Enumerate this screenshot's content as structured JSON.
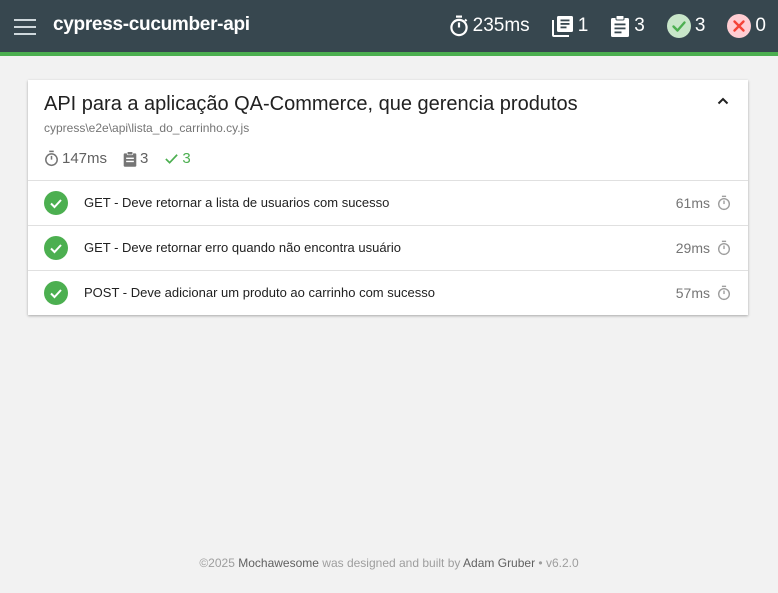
{
  "app": {
    "title": "cypress-cucumber-api",
    "menu_icon": "hamburger-menu-icon"
  },
  "header_stats": {
    "duration": "235ms",
    "suites": "1",
    "tests": "3",
    "passed": "3",
    "failed": "0",
    "colors": {
      "bar": "#37474f",
      "accent": "#4caf50",
      "passed_badge": "#c8e6c9",
      "failed_badge": "#ffcdd2",
      "failed_icon": "#f44336"
    }
  },
  "suite": {
    "title": "API para a aplicação QA-Commerce, que gerencia produtos",
    "file": "cypress\\e2e\\api\\lista_do_carrinho.cy.js",
    "duration": "147ms",
    "tests": [
      {
        "title": "GET - Deve retornar a lista de usuarios com sucesso",
        "duration": "61ms",
        "state": "passed"
      },
      {
        "title": "GET - Deve retornar erro quando não encontra usuário",
        "duration": "29ms",
        "state": "passed"
      },
      {
        "title": "POST - Deve adicionar um produto ao carrinho com sucesso",
        "duration": "57ms",
        "state": "passed"
      }
    ],
    "passed": "3"
  },
  "suite_counts": {
    "tests": "3",
    "passed": "3"
  },
  "footer": {
    "copyright": "©2025",
    "brand": "Mochawesome",
    "middle": "was designed and built by",
    "author": "Adam Gruber",
    "version": "• v6.2.0"
  }
}
